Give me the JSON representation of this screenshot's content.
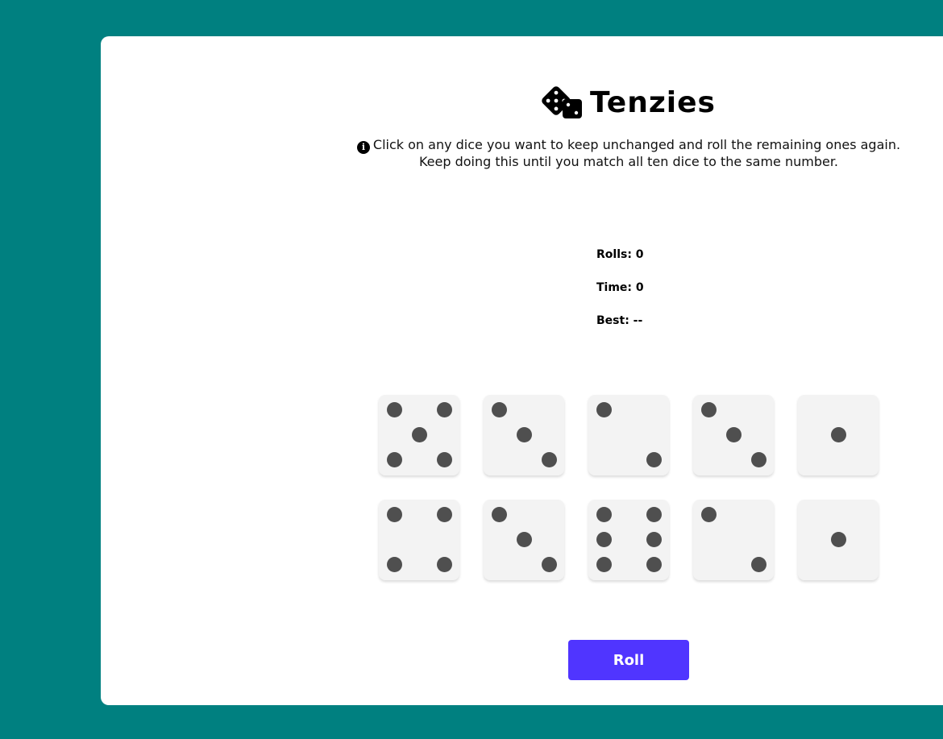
{
  "header": {
    "title": "Tenzies",
    "icon": "dice-icon"
  },
  "instructions": {
    "icon": "info-icon",
    "line1": "Click on any dice you want to keep unchanged and roll the remaining ones again.",
    "line2": "Keep doing this until you match all ten dice to the same number."
  },
  "stats": {
    "rolls": "Rolls: 0",
    "time": "Time: 0",
    "best": "Best: --"
  },
  "dice": [
    5,
    3,
    2,
    3,
    1,
    4,
    3,
    6,
    2,
    1
  ],
  "roll_button": {
    "label": "Roll"
  },
  "colors": {
    "background": "#008080",
    "card": "#ffffff",
    "die_face": "#f3f3f3",
    "pip": "#4f4f4f",
    "button": "#5035ff"
  }
}
